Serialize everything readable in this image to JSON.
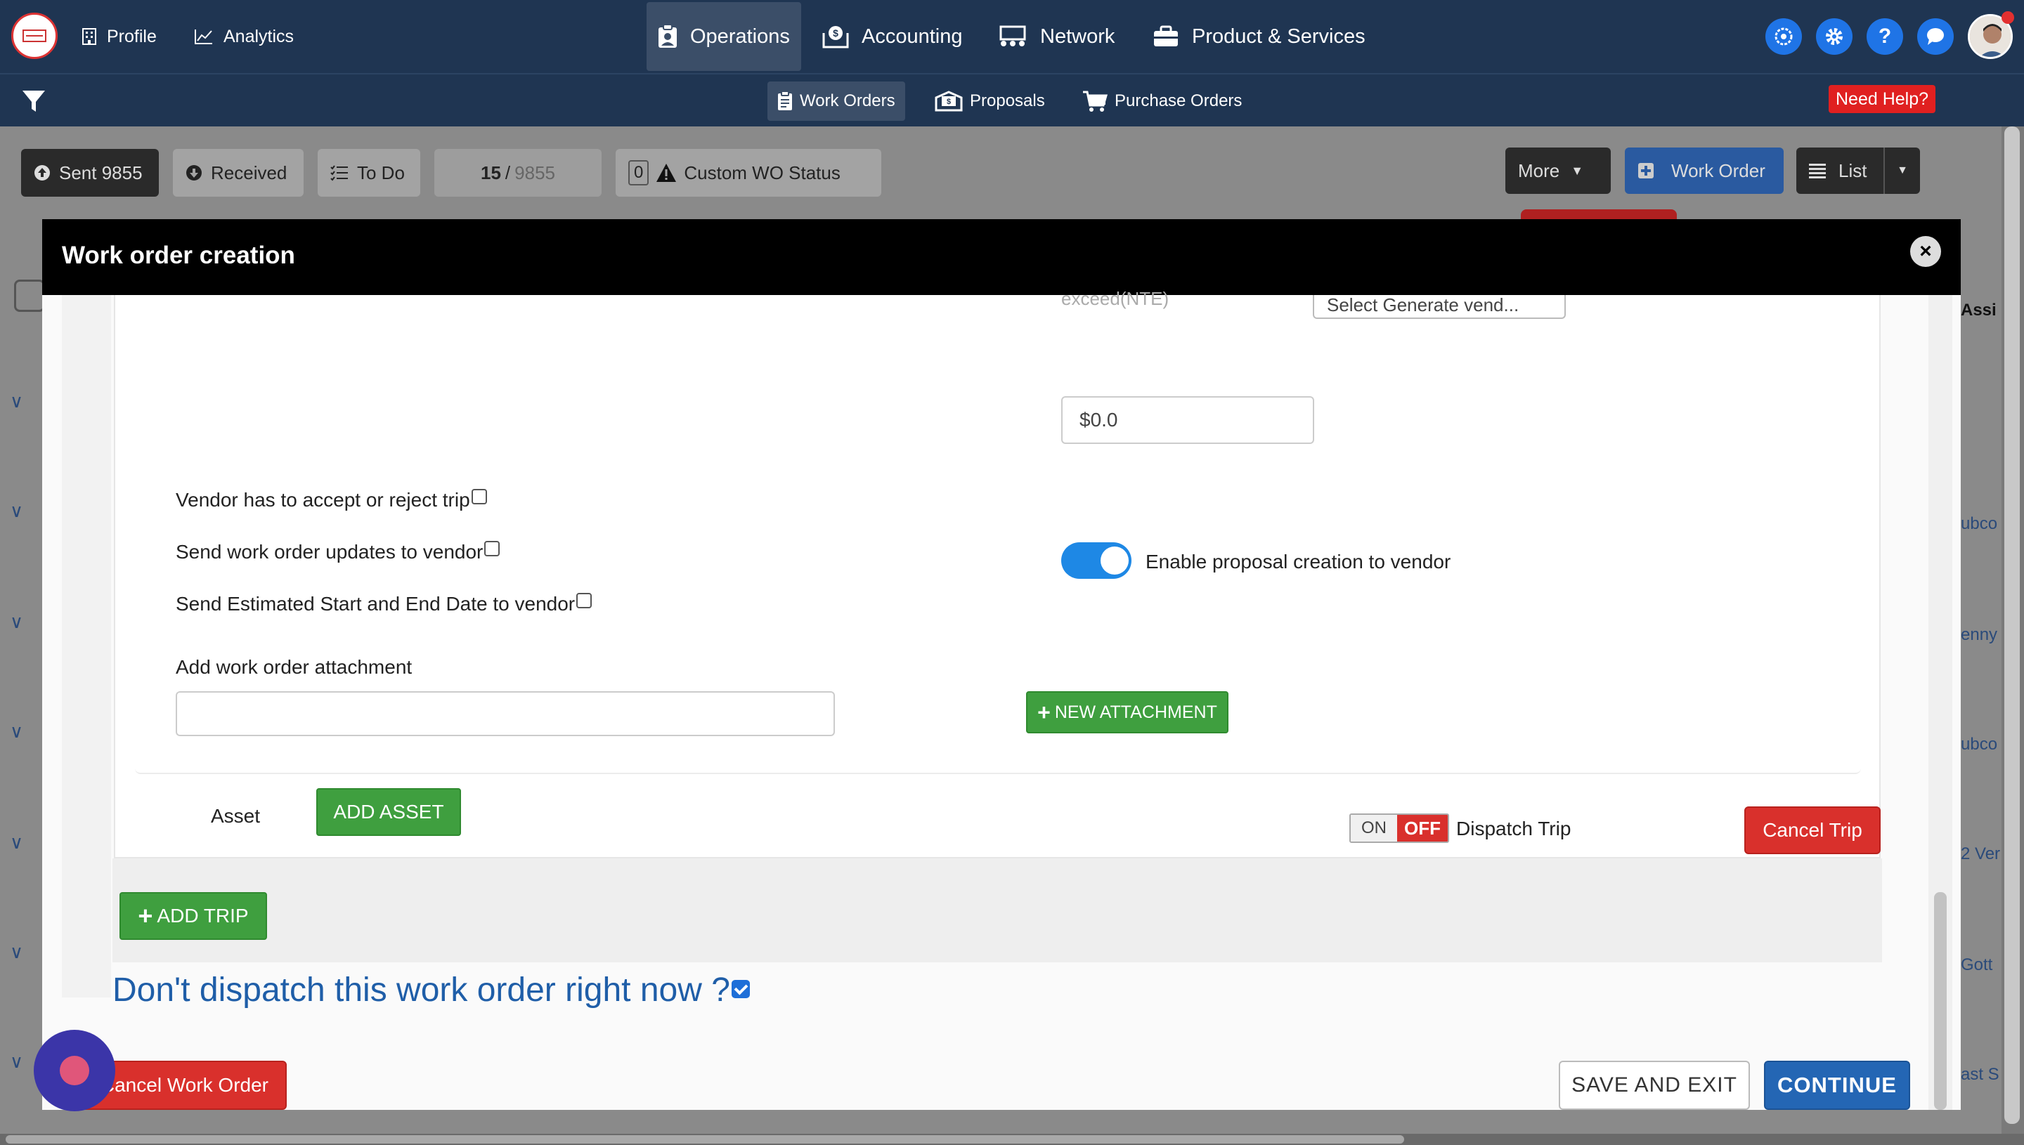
{
  "topnav": {
    "profile": "Profile",
    "analytics": "Analytics",
    "operations": "Operations",
    "accounting": "Accounting",
    "network": "Network",
    "products": "Product & Services"
  },
  "subnav": {
    "work_orders": "Work Orders",
    "proposals": "Proposals",
    "purchase_orders": "Purchase Orders",
    "need_help": "Need Help?"
  },
  "toolbar": {
    "sent": "Sent 9855",
    "received": "Received",
    "todo": "To Do",
    "page_current": "15",
    "page_sep": "/",
    "page_total": "9855",
    "custom_count": "0",
    "custom_status": "Custom WO Status",
    "more": "More",
    "work_order": "Work Order",
    "list": "List"
  },
  "background_rows": [
    "Assi",
    "ubco",
    "enny",
    "ubco",
    "2 Ver",
    "Gott",
    "ast S"
  ],
  "modal": {
    "title": "Work order creation",
    "nte_label": "exceed(NTE)",
    "nte_value": "$0.0",
    "select_vendor": "Select Generate vend...",
    "vendor_accept": "Vendor has to accept or reject trip",
    "send_updates": "Send work order updates to vendor",
    "send_dates": "Send Estimated Start and End Date to vendor",
    "enable_proposal": "Enable proposal creation to vendor",
    "attachment_label": "Add work order attachment",
    "new_attachment": "NEW ATTACHMENT",
    "asset_label": "Asset",
    "add_asset": "ADD ASSET",
    "on": "ON",
    "off": "OFF",
    "dispatch_trip": "Dispatch Trip",
    "cancel_trip": "Cancel Trip",
    "add_trip": "ADD TRIP",
    "dont_dispatch": "Don't dispatch this work order right now ?",
    "cancel_work_order": "Cancel Work Order",
    "save_and_exit": "SAVE AND EXIT",
    "continue": "CONTINUE"
  },
  "colors": {
    "nav_bg": "#1f3552",
    "accent_blue": "#1e88e5",
    "green": "#3f9f3f",
    "red": "#d9302c",
    "heading_blue": "#1f5ea8"
  }
}
